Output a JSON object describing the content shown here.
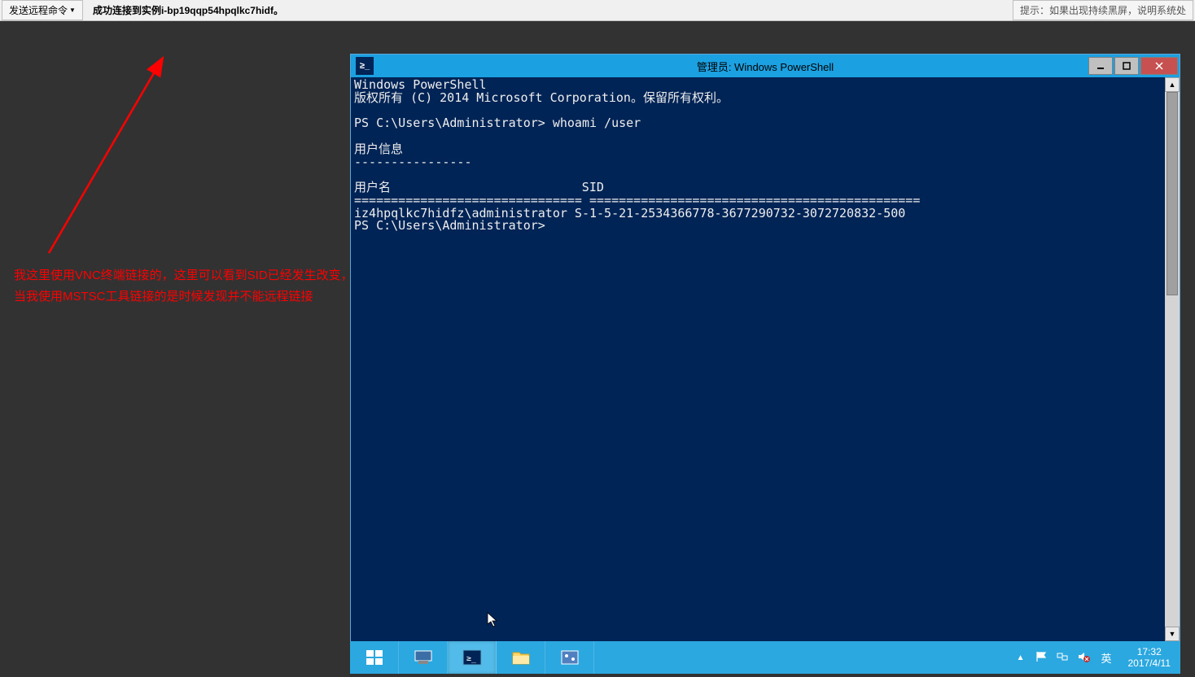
{
  "vnc": {
    "send_cmd_label": "发送远程命令",
    "status_text": "成功连接到实例i-bp19qqp54hpqlkc7hidf。",
    "tip_text": "提示：如果出现持续黑屏，说明系统处"
  },
  "annotation": {
    "line1": "我这里使用VNC终端链接的，这里可以看到SID已经发生改变，",
    "line2": "当我使用MSTSC工具链接的是时候发现并不能远程链接"
  },
  "powershell": {
    "title": "管理员: Windows PowerShell",
    "content": "Windows PowerShell\n版权所有 (C) 2014 Microsoft Corporation。保留所有权利。\n\nPS C:\\Users\\Administrator> whoami /user\n\n用户信息\n----------------\n\n用户名                          SID\n=============================== =============================================\niz4hpqlkc7hidfz\\administrator S-1-5-21-2534366778-3677290732-3072720832-500\nPS C:\\Users\\Administrator>"
  },
  "tray": {
    "lang": "英",
    "time": "17:32",
    "date": "2017/4/11"
  }
}
